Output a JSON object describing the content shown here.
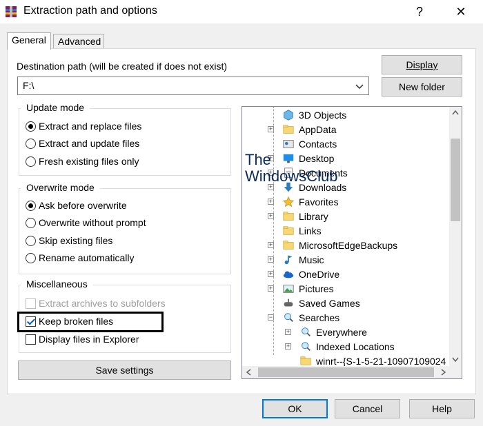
{
  "window": {
    "title": "Extraction path and options",
    "help_glyph": "?",
    "close_glyph": "✕"
  },
  "tabs": [
    {
      "label": "General"
    },
    {
      "label": "Advanced"
    }
  ],
  "destination": {
    "label": "Destination path (will be created if does not exist)",
    "value": "F:\\",
    "display_button": "Display",
    "new_folder_button": "New folder"
  },
  "update_mode": {
    "title": "Update mode",
    "options": [
      {
        "label": "Extract and replace files",
        "selected": true
      },
      {
        "label": "Extract and update files",
        "selected": false
      },
      {
        "label": "Fresh existing files only",
        "selected": false
      }
    ]
  },
  "overwrite_mode": {
    "title": "Overwrite mode",
    "options": [
      {
        "label": "Ask before overwrite",
        "selected": true
      },
      {
        "label": "Overwrite without prompt",
        "selected": false
      },
      {
        "label": "Skip existing files",
        "selected": false
      },
      {
        "label": "Rename automatically",
        "selected": false
      }
    ]
  },
  "misc": {
    "title": "Miscellaneous",
    "options": [
      {
        "label": "Extract archives to subfolders",
        "checked": false,
        "disabled": true
      },
      {
        "label": "Keep broken files",
        "checked": true,
        "disabled": false
      },
      {
        "label": "Display files in Explorer",
        "checked": false,
        "disabled": false
      }
    ]
  },
  "save_settings_button": "Save settings",
  "tree": {
    "items": [
      {
        "label": "3D Objects",
        "icon": "3d-objects-icon",
        "expander": false
      },
      {
        "label": "AppData",
        "icon": "folder-icon",
        "expander": true
      },
      {
        "label": "Contacts",
        "icon": "contacts-icon",
        "expander": false
      },
      {
        "label": "Desktop",
        "icon": "desktop-icon",
        "expander": true
      },
      {
        "label": "Documents",
        "icon": "documents-icon",
        "expander": true
      },
      {
        "label": "Downloads",
        "icon": "downloads-icon",
        "expander": true
      },
      {
        "label": "Favorites",
        "icon": "star-icon",
        "expander": true
      },
      {
        "label": "Library",
        "icon": "folder-icon",
        "expander": true
      },
      {
        "label": "Links",
        "icon": "folder-icon",
        "expander": false
      },
      {
        "label": "MicrosoftEdgeBackups",
        "icon": "folder-icon",
        "expander": true
      },
      {
        "label": "Music",
        "icon": "music-icon",
        "expander": true
      },
      {
        "label": "OneDrive",
        "icon": "cloud-icon",
        "expander": true
      },
      {
        "label": "Pictures",
        "icon": "pictures-icon",
        "expander": true
      },
      {
        "label": "Saved Games",
        "icon": "saved-games-icon",
        "expander": false
      },
      {
        "label": "Searches",
        "icon": "search-folder-icon",
        "expander": true,
        "expanded": true
      },
      {
        "label": "Everywhere",
        "icon": "search-folder-icon",
        "expander": true,
        "level": 2
      },
      {
        "label": "Indexed Locations",
        "icon": "search-folder-icon",
        "expander": true,
        "level": 2
      },
      {
        "label": "winrt--{S-1-5-21-10907109024",
        "icon": "folder-icon",
        "expander": false,
        "level": 2
      }
    ]
  },
  "watermark": {
    "line1": "The",
    "line2": "WindowsClub"
  },
  "footer": {
    "ok": "OK",
    "cancel": "Cancel",
    "help": "Help"
  },
  "colors": {
    "accent": "#0078d7",
    "folder": "#f8d775",
    "dialog_bg": "#f0f0f0"
  }
}
